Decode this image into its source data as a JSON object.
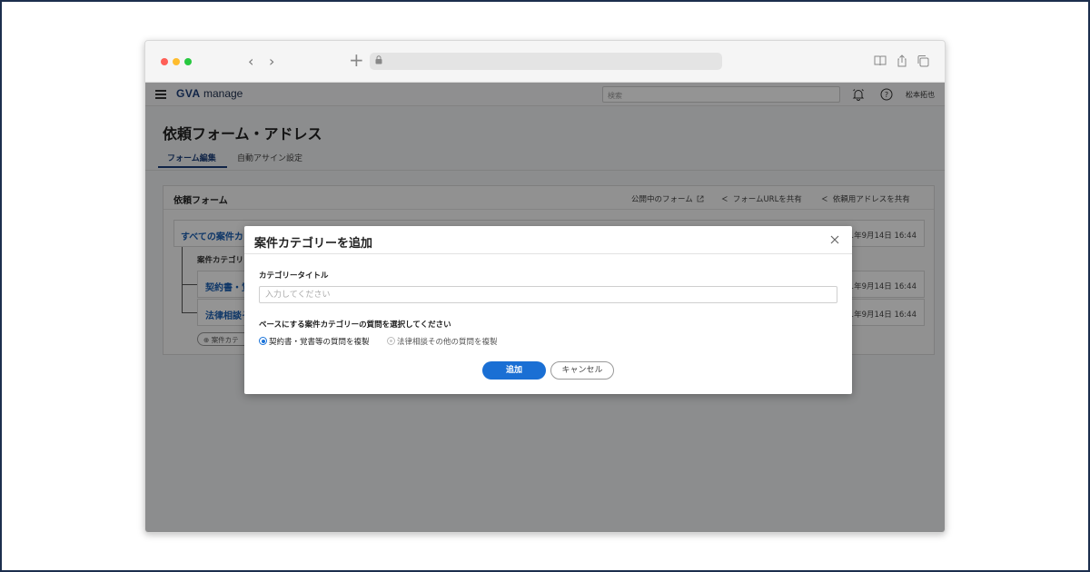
{
  "browser": {
    "url": ""
  },
  "app": {
    "logo_brand": "GVA",
    "logo_product": "manage",
    "search_placeholder": "検索",
    "user_name": "松本拓也"
  },
  "page": {
    "title": "依頼フォーム・アドレス",
    "tabs": [
      {
        "label": "フォーム編集",
        "active": true
      },
      {
        "label": "自動アサイン設定",
        "active": false
      }
    ]
  },
  "card": {
    "title": "依頼フォーム",
    "links": {
      "published_form": "公開中のフォーム",
      "share_form_url": "フォームURLを共有",
      "share_request_address": "依頼用アドレスを共有"
    },
    "all_row": {
      "label": "すべての案件カ",
      "date": "21年9月14日 16:44"
    },
    "sub_label": "案件カテゴリ",
    "categories": [
      {
        "label": "契約書・覚",
        "date": "21年9月14日 16:44"
      },
      {
        "label": "法律相談そ",
        "date": "21年9月14日 16:44"
      }
    ],
    "add_category_button": "案件カテ"
  },
  "modal": {
    "title": "案件カテゴリーを追加",
    "title_field_label": "カテゴリータイトル",
    "title_field_placeholder": "入力してください",
    "title_field_value": "",
    "base_label": "ベースにする案件カテゴリーの質問を選択してください",
    "options": [
      {
        "label": "契約書・覚書等の質問を複製",
        "selected": true
      },
      {
        "label": "法律相談その他の質問を複製",
        "selected": false
      }
    ],
    "add_button": "追加",
    "cancel_button": "キャンセル"
  },
  "colors": {
    "accent": "#1a6fd4",
    "link": "#1a5fb4",
    "brand": "#1c3f7a",
    "overlay": "rgba(0,0,0,0.42)"
  }
}
